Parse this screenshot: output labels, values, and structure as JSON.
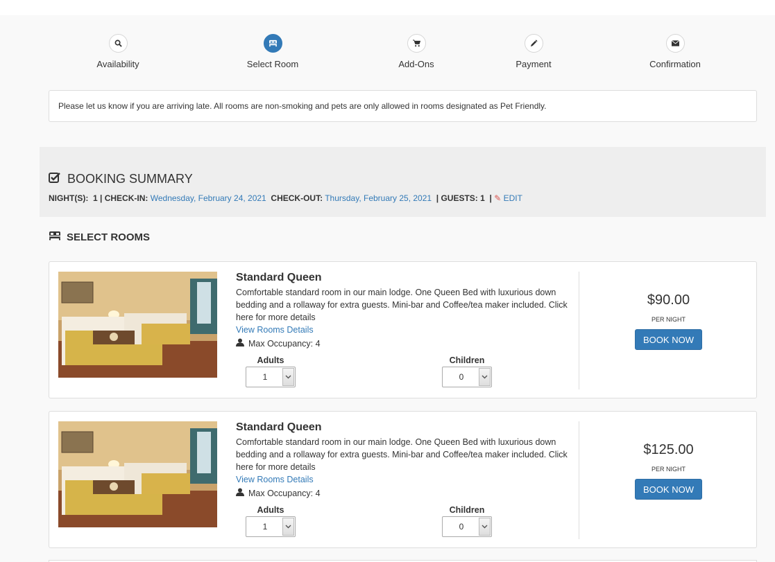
{
  "steps": [
    {
      "label": "Availability",
      "icon": "search-icon",
      "active": false
    },
    {
      "label": "Select Room",
      "icon": "bed-icon",
      "active": true
    },
    {
      "label": "Add-Ons",
      "icon": "cart-icon",
      "active": false
    },
    {
      "label": "Payment",
      "icon": "pencil-icon",
      "active": false
    },
    {
      "label": "Confirmation",
      "icon": "envelope-icon",
      "active": false
    }
  ],
  "notice": "Please let us know if you are arriving late. All rooms are non-smoking and pets are only allowed in rooms designated as Pet Friendly.",
  "summary": {
    "title": "BOOKING SUMMARY",
    "nights_label": "NIGHT(S):",
    "nights": "1",
    "checkin_label": "| CHECK-IN:",
    "checkin": "Wednesday, February 24, 2021",
    "checkout_label": "CHECK-OUT:",
    "checkout": "Thursday, February 25, 2021",
    "guests_label": "| GUESTS:",
    "guests": "1",
    "sep": "|",
    "edit": "EDIT"
  },
  "select_rooms_title": "SELECT ROOMS",
  "rooms": [
    {
      "name": "Standard Queen",
      "description": "Comfortable standard room in our main lodge. One Queen Bed with luxurious down bedding and a rollaway for extra guests. Mini-bar and Coffee/tea maker included. Click here for more details",
      "details_link": "View Rooms Details",
      "occupancy": "Max Occupancy: 4",
      "adults_label": "Adults",
      "adults": "1",
      "children_label": "Children",
      "children": "0",
      "price": "$90.00",
      "per_night": "PER NIGHT",
      "book_label": "BOOK NOW"
    },
    {
      "name": "Standard Queen",
      "description": "Comfortable standard room in our main lodge. One Queen Bed with luxurious down bedding and a rollaway for extra guests. Mini-bar and Coffee/tea maker included. Click here for more details",
      "details_link": "View Rooms Details",
      "occupancy": "Max Occupancy: 4",
      "adults_label": "Adults",
      "adults": "1",
      "children_label": "Children",
      "children": "0",
      "price": "$125.00",
      "per_night": "PER NIGHT",
      "book_label": "BOOK NOW"
    }
  ],
  "colors": {
    "accent": "#337ab7",
    "edit_pencil": "#d9534f"
  }
}
